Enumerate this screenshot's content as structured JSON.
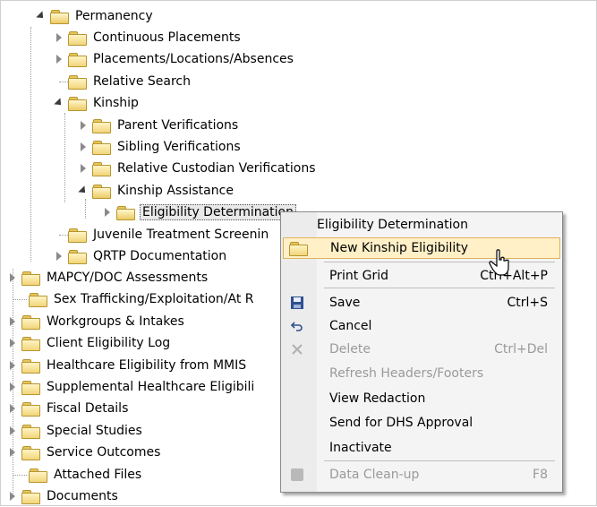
{
  "tree": {
    "nodes": [
      {
        "label": "Permanency",
        "expander": "open"
      },
      {
        "label": "Continuous Placements",
        "expander": "closed"
      },
      {
        "label": "Placements/Locations/Absences",
        "expander": "closed"
      },
      {
        "label": "Relative Search",
        "expander": "none"
      },
      {
        "label": "Kinship",
        "expander": "open"
      },
      {
        "label": "Parent Verifications",
        "expander": "closed"
      },
      {
        "label": "Sibling Verifications",
        "expander": "closed"
      },
      {
        "label": "Relative Custodian Verifications",
        "expander": "closed"
      },
      {
        "label": "Kinship Assistance",
        "expander": "open"
      },
      {
        "label": "Eligibility Determination",
        "expander": "closed"
      },
      {
        "label": "Juvenile Treatment Screenin",
        "expander": "none"
      },
      {
        "label": "QRTP Documentation",
        "expander": "closed"
      },
      {
        "label": "MAPCY/DOC Assessments",
        "expander": "closed"
      },
      {
        "label": "Sex Trafficking/Exploitation/At R",
        "expander": "none"
      },
      {
        "label": "Workgroups & Intakes",
        "expander": "closed"
      },
      {
        "label": "Client Eligibility Log",
        "expander": "closed"
      },
      {
        "label": "Healthcare Eligibility from MMIS",
        "expander": "closed"
      },
      {
        "label": "Supplemental Healthcare Eligibili",
        "expander": "closed"
      },
      {
        "label": "Fiscal Details",
        "expander": "closed"
      },
      {
        "label": "Special Studies",
        "expander": "closed"
      },
      {
        "label": "Service Outcomes",
        "expander": "closed"
      },
      {
        "label": "Attached Files",
        "expander": "none"
      },
      {
        "label": "Documents",
        "expander": "closed"
      }
    ]
  },
  "context_menu": {
    "title": "Eligibility Determination",
    "items": [
      {
        "label": "New Kinship Eligibility",
        "shortcut": "",
        "enabled": true,
        "icon": "folder-icon"
      },
      {
        "label": "Print Grid",
        "shortcut": "Ctrl+Alt+P",
        "enabled": true,
        "icon": ""
      },
      {
        "label": "Save",
        "shortcut": "Ctrl+S",
        "enabled": true,
        "icon": "save-icon"
      },
      {
        "label": "Cancel",
        "shortcut": "",
        "enabled": true,
        "icon": "undo-icon"
      },
      {
        "label": "Delete",
        "shortcut": "Ctrl+Del",
        "enabled": false,
        "icon": "delete-x-icon"
      },
      {
        "label": "Refresh Headers/Footers",
        "shortcut": "",
        "enabled": false,
        "icon": ""
      },
      {
        "label": "View Redaction",
        "shortcut": "",
        "enabled": true,
        "icon": ""
      },
      {
        "label": "Send for DHS Approval",
        "shortcut": "",
        "enabled": true,
        "icon": ""
      },
      {
        "label": "Inactivate",
        "shortcut": "",
        "enabled": true,
        "icon": ""
      },
      {
        "label": "Data Clean-up",
        "shortcut": "F8",
        "enabled": false,
        "icon": "cleanup-icon"
      }
    ]
  },
  "colors": {
    "menu_highlight": "#fff0c8",
    "menu_highlight_border": "#e2b259",
    "folder_fill": "#f1d57a",
    "disabled_text": "#9a9a9a"
  }
}
